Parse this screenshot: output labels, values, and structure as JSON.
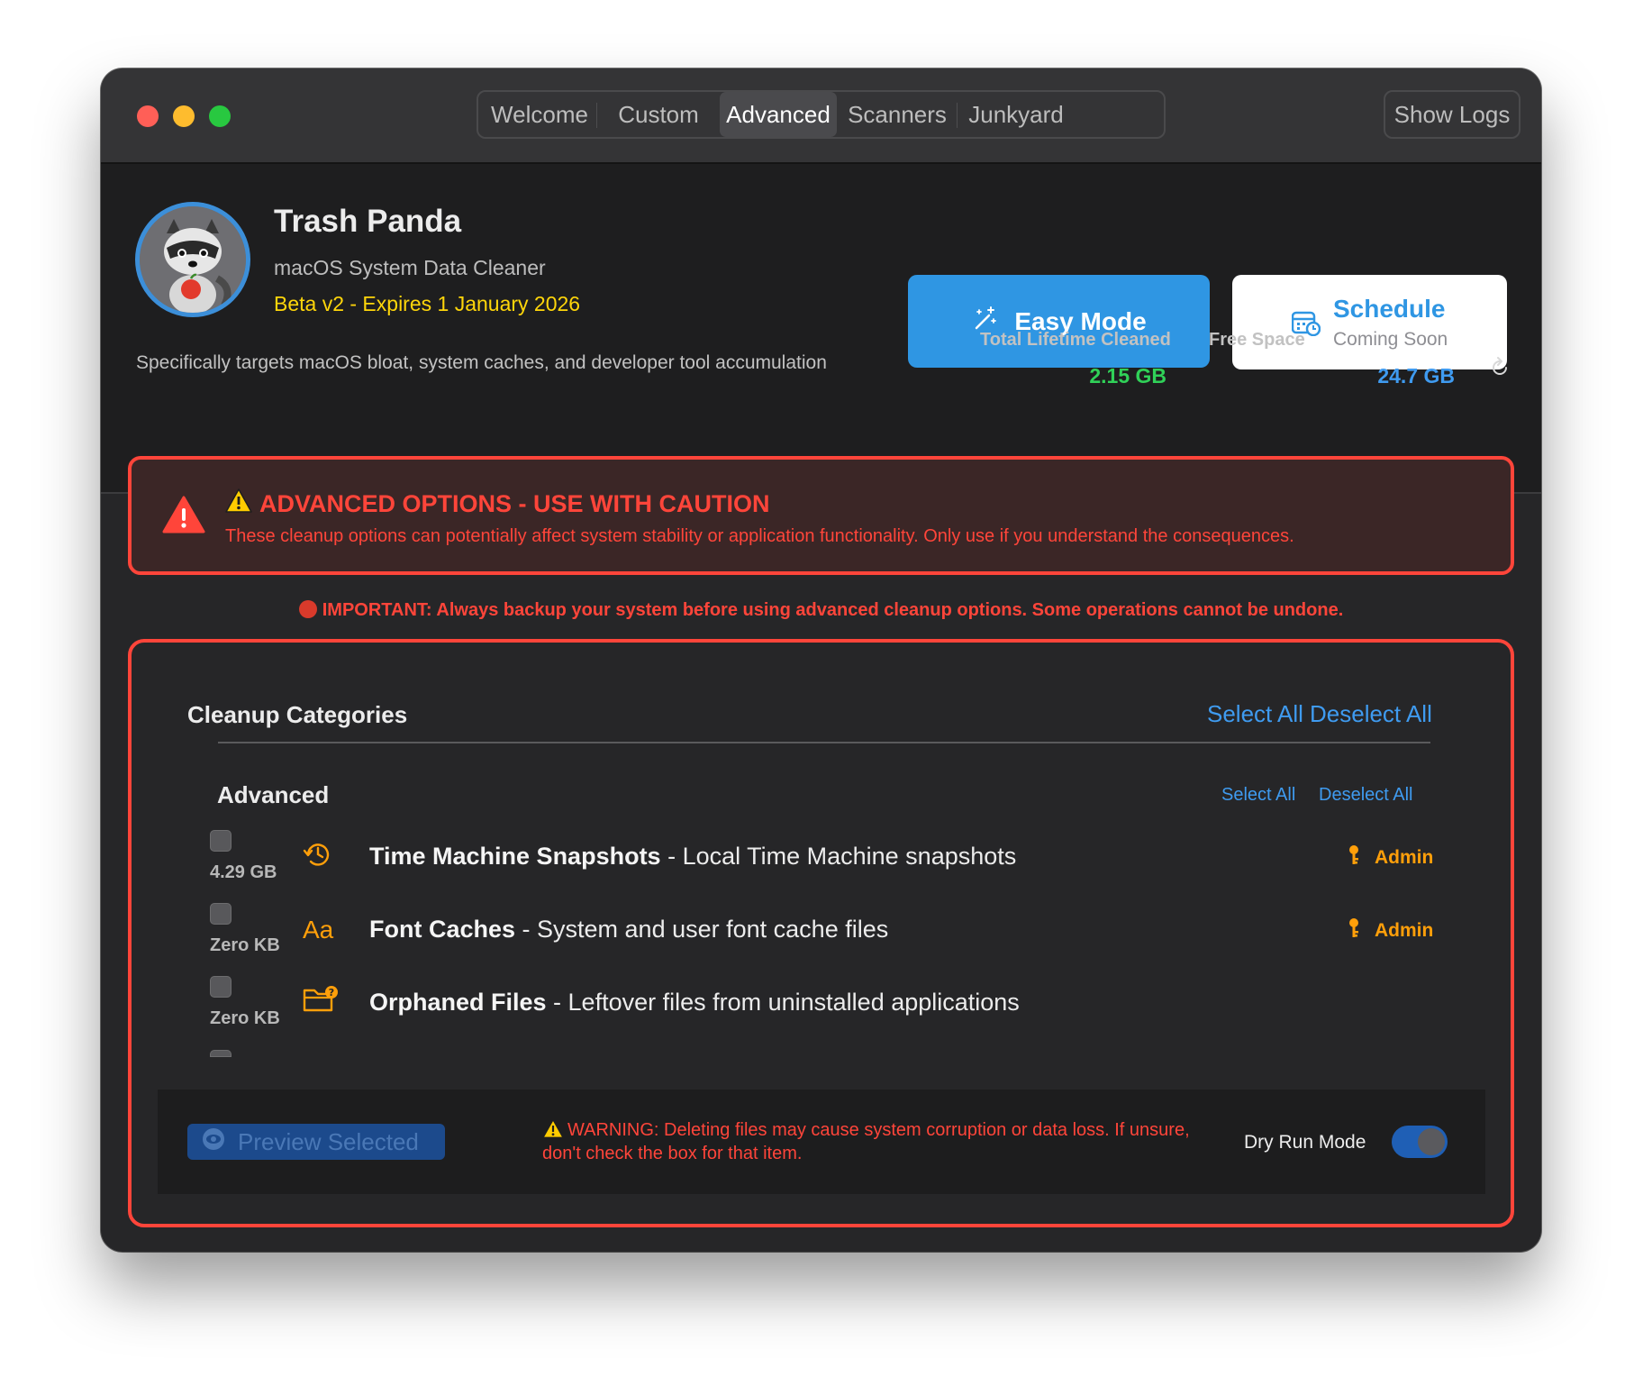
{
  "window": {
    "tabs": [
      {
        "label": "Welcome",
        "active": false
      },
      {
        "label": "Custom",
        "active": false
      },
      {
        "label": "Advanced",
        "active": true
      },
      {
        "label": "Scanners",
        "active": false
      },
      {
        "label": "Junkyard",
        "active": false
      }
    ],
    "show_logs_label": "Show Logs"
  },
  "header": {
    "app_name": "Trash Panda",
    "subtitle": "macOS System Data Cleaner",
    "beta": "Beta v2 - Expires 1 January 2026",
    "description": "Specifically targets macOS bloat, system caches, and developer tool accumulation",
    "easy_mode_label": "Easy Mode",
    "schedule_label": "Schedule",
    "schedule_sub": "Coming Soon",
    "stats": {
      "lifetime_label": "Total Lifetime Cleaned",
      "lifetime_value": "2.15 GB",
      "free_label": "Free Space",
      "free_value": "24.7 GB"
    }
  },
  "caution": {
    "title": "ADVANCED OPTIONS - USE WITH CAUTION",
    "text": "These cleanup options can potentially affect system stability or application functionality. Only use if you understand the consequences."
  },
  "important": "IMPORTANT: Always backup your system before using advanced cleanup options. Some operations cannot be undone.",
  "categories": {
    "title": "Cleanup Categories",
    "select_all": "Select All",
    "deselect_all": "Deselect All",
    "group": {
      "title": "Advanced",
      "select_all": "Select All",
      "deselect_all": "Deselect All",
      "items": [
        {
          "size": "4.29 GB",
          "icon": "history-clock-icon",
          "name": "Time Machine Snapshots",
          "desc": " - Local Time Machine snapshots",
          "badge": "Admin",
          "checked": false
        },
        {
          "size": "Zero KB",
          "icon": "font-aa-icon",
          "name": "Font Caches",
          "desc": " - System and user font cache files",
          "badge": "Admin",
          "checked": false
        },
        {
          "size": "Zero KB",
          "icon": "folder-question-icon",
          "name": "Orphaned Files",
          "desc": " - Leftover files from uninstalled applications",
          "badge": "",
          "checked": false
        }
      ]
    }
  },
  "footer": {
    "preview_label": "Preview Selected",
    "warning": "WARNING: Deleting files may cause system corruption or data loss. If unsure, don't check the box for that item.",
    "dry_run_label": "Dry Run Mode",
    "dry_run_on": true
  },
  "colors": {
    "accent": "#2f96e3",
    "danger": "#ff453a",
    "beta": "#ffd60a",
    "lifetime": "#30d158",
    "free": "#3f9bf0",
    "admin": "#ff9f0a"
  }
}
